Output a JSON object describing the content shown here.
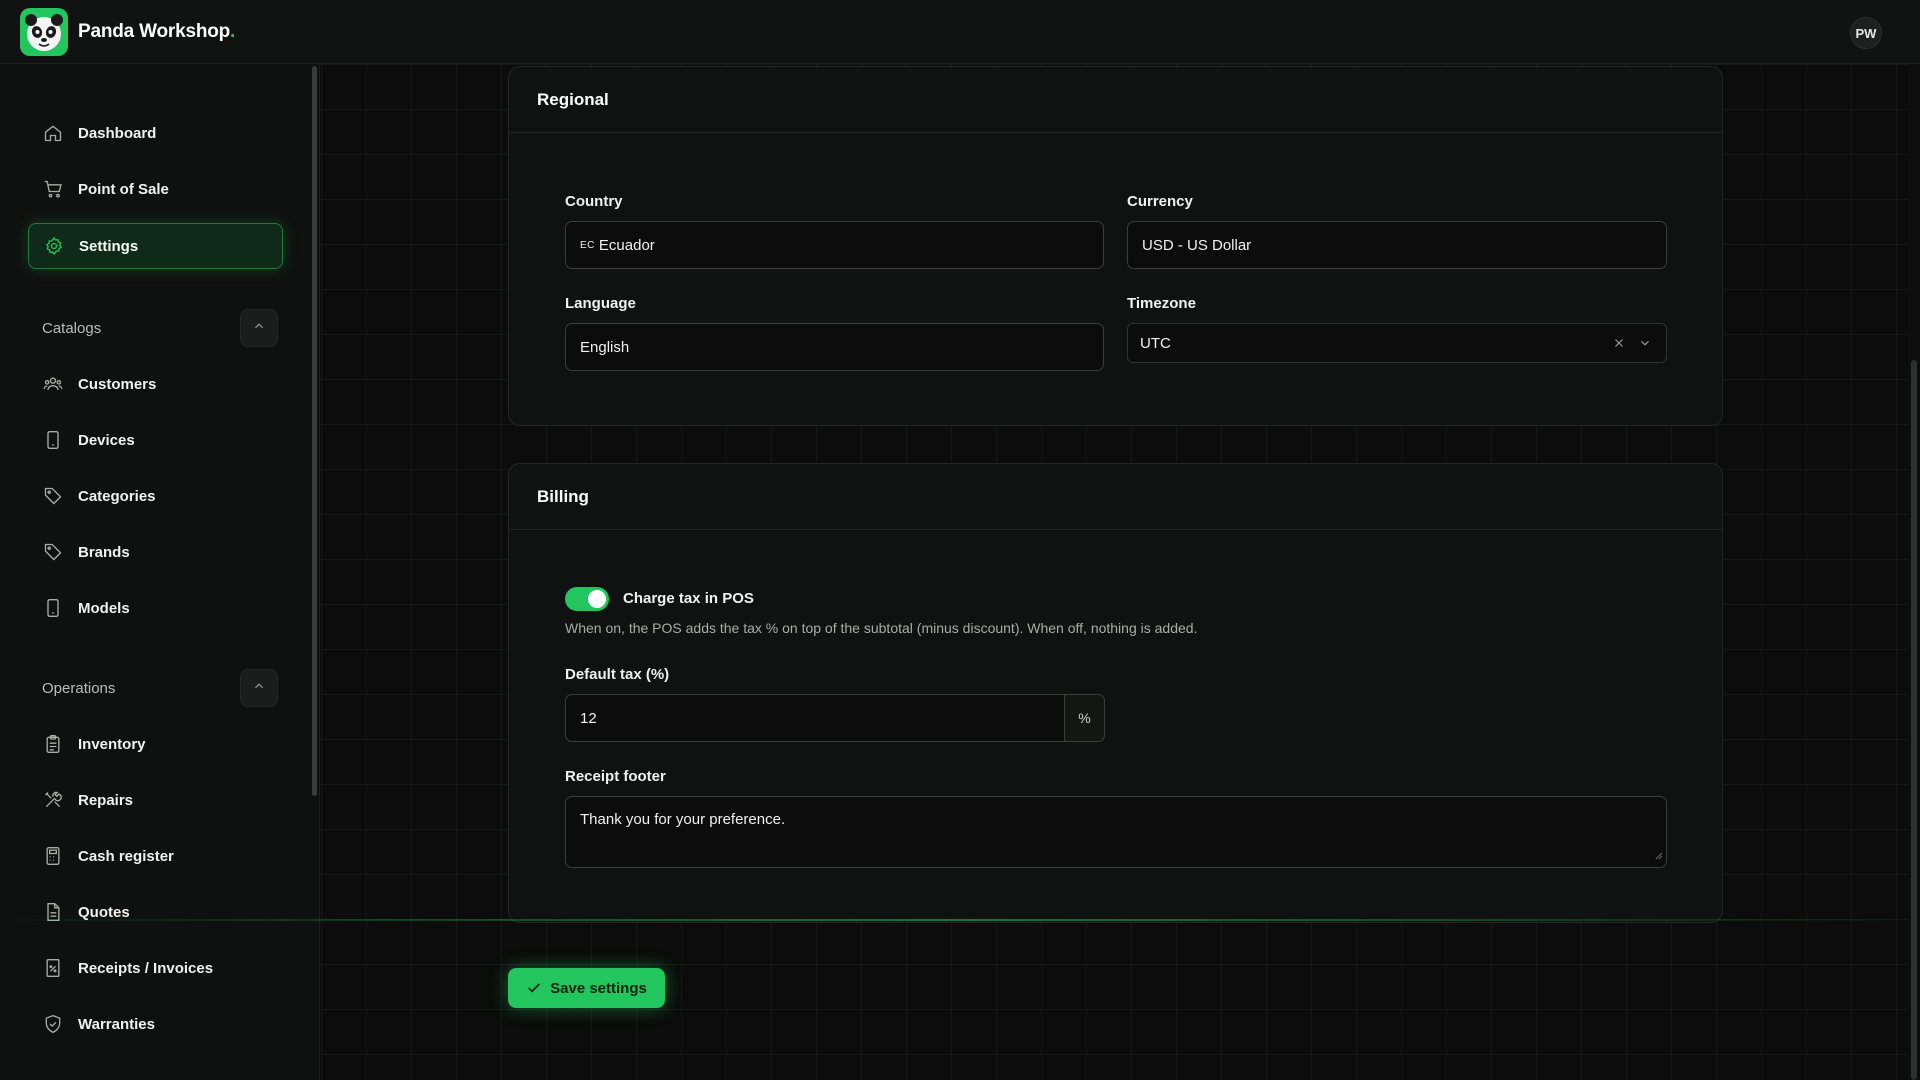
{
  "header": {
    "brand_name": "Panda Workshop",
    "brand_dot": ".",
    "user_initials": "PW"
  },
  "sidebar": {
    "items": [
      {
        "label": "Dashboard",
        "icon": "home-icon"
      },
      {
        "label": "Point of Sale",
        "icon": "cart-icon"
      },
      {
        "label": "Settings",
        "icon": "gear-icon",
        "active": true
      }
    ],
    "catalogs_label": "Catalogs",
    "catalogs": [
      {
        "label": "Customers",
        "icon": "users-icon"
      },
      {
        "label": "Devices",
        "icon": "phone-icon"
      },
      {
        "label": "Categories",
        "icon": "tag-icon"
      },
      {
        "label": "Brands",
        "icon": "tag-icon"
      },
      {
        "label": "Models",
        "icon": "phone-icon"
      }
    ],
    "operations_label": "Operations",
    "operations": [
      {
        "label": "Inventory",
        "icon": "clipboard-icon"
      },
      {
        "label": "Repairs",
        "icon": "tools-icon"
      },
      {
        "label": "Cash register",
        "icon": "calculator-icon"
      },
      {
        "label": "Quotes",
        "icon": "document-icon"
      },
      {
        "label": "Receipts / Invoices",
        "icon": "receipt-icon"
      },
      {
        "label": "Warranties",
        "icon": "shield-check-icon"
      }
    ]
  },
  "regional": {
    "title": "Regional",
    "country_label": "Country",
    "country_flag": "EC",
    "country_value": "Ecuador",
    "currency_label": "Currency",
    "currency_value": "USD - US Dollar",
    "language_label": "Language",
    "language_value": "English",
    "timezone_label": "Timezone",
    "timezone_value": "UTC"
  },
  "billing": {
    "title": "Billing",
    "charge_tax_label": "Charge tax in POS",
    "charge_tax_on": true,
    "charge_tax_help": "When on, the POS adds the tax % on top of the subtotal (minus discount). When off, nothing is added.",
    "default_tax_label": "Default tax (%)",
    "default_tax_value": "12",
    "default_tax_suffix": "%",
    "receipt_footer_label": "Receipt footer",
    "receipt_footer_value": "Thank you for your preference."
  },
  "actions": {
    "save_label": "Save settings"
  },
  "colors": {
    "accent": "#22c55e",
    "background": "#0a0b0a",
    "card": "#101211"
  }
}
